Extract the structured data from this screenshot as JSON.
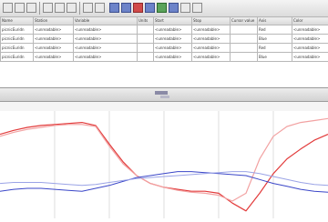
{
  "toolbar": {
    "buttons": [
      "open-icon",
      "save-icon",
      "print-icon",
      "cut-icon",
      "copy-icon",
      "paste-icon",
      "undo-icon",
      "redo-icon",
      "zoom-in-icon",
      "zoom-out-icon",
      "chart-icon",
      "table-icon",
      "filter-icon",
      "refresh-icon",
      "settings-icon",
      "help-icon"
    ]
  },
  "grid": {
    "columns": [
      "Name",
      "Station",
      "Variable",
      "Units",
      "Start",
      "Stop",
      "Cursor value",
      "Axis",
      "Color"
    ],
    "rows": [
      {
        "name": "picnicEuridn",
        "station": "<unreadable>",
        "variable": "<unreadable>",
        "units": "",
        "start": "<unreadable>",
        "stop": "<unreadable>",
        "cursor": "",
        "axis": "Red",
        "color": "<unreadable>"
      },
      {
        "name": "picnicEuridn",
        "station": "<unreadable>",
        "variable": "<unreadable>",
        "units": "",
        "start": "<unreadable>",
        "stop": "<unreadable>",
        "cursor": "",
        "axis": "Blue",
        "color": "<unreadable>"
      },
      {
        "name": "picnicEuridn",
        "station": "<unreadable>",
        "variable": "<unreadable>",
        "units": "",
        "start": "<unreadable>",
        "stop": "<unreadable>",
        "cursor": "",
        "axis": "Red",
        "color": "<unreadable>"
      },
      {
        "name": "picnicEuridn",
        "station": "<unreadable>",
        "variable": "<unreadable>",
        "units": "",
        "start": "<unreadable>",
        "stop": "<unreadable>",
        "cursor": "",
        "axis": "Blue",
        "color": "<unreadable>"
      }
    ]
  },
  "timebar": {
    "labels": [
      "",
      "",
      "",
      ""
    ]
  },
  "colors": {
    "red": "#e23b3b",
    "light_red": "#f2a2a2",
    "blue": "#3a46c8",
    "light_blue": "#9aa3e6",
    "grid": "#c9c9c9"
  },
  "chart_data": {
    "type": "line",
    "x": [
      0,
      1,
      2,
      3,
      4,
      5,
      6,
      7,
      8,
      9,
      10,
      11,
      12,
      13,
      14,
      15,
      16,
      17,
      18,
      19,
      20,
      21,
      22,
      23,
      24
    ],
    "series": [
      {
        "values": [
          0.8,
          0.84,
          0.87,
          0.89,
          0.9,
          0.91,
          0.92,
          0.89,
          0.7,
          0.52,
          0.38,
          0.3,
          0.26,
          0.24,
          0.22,
          0.22,
          0.2,
          0.1,
          0.02,
          0.2,
          0.4,
          0.55,
          0.65,
          0.74,
          0.8
        ]
      },
      {
        "values": [
          0.78,
          0.82,
          0.85,
          0.87,
          0.89,
          0.9,
          0.9,
          0.88,
          0.68,
          0.5,
          0.38,
          0.3,
          0.26,
          0.23,
          0.21,
          0.2,
          0.18,
          0.12,
          0.2,
          0.55,
          0.78,
          0.88,
          0.92,
          0.94,
          0.96
        ]
      },
      {
        "values": [
          0.22,
          0.24,
          0.25,
          0.25,
          0.24,
          0.23,
          0.22,
          0.25,
          0.28,
          0.32,
          0.36,
          0.38,
          0.4,
          0.42,
          0.42,
          0.41,
          0.4,
          0.39,
          0.38,
          0.34,
          0.3,
          0.27,
          0.24,
          0.22,
          0.21
        ]
      },
      {
        "values": [
          0.3,
          0.31,
          0.31,
          0.31,
          0.3,
          0.29,
          0.28,
          0.29,
          0.31,
          0.33,
          0.35,
          0.36,
          0.37,
          0.38,
          0.39,
          0.4,
          0.41,
          0.42,
          0.42,
          0.4,
          0.37,
          0.34,
          0.31,
          0.29,
          0.28
        ]
      }
    ],
    "ylim": [
      0,
      1
    ],
    "grid": true
  }
}
